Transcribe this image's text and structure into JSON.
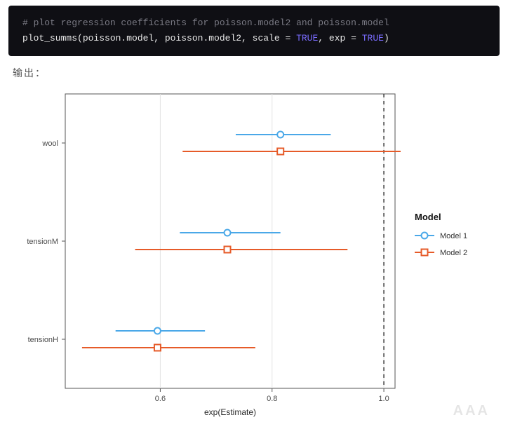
{
  "code": {
    "comment": "# plot regression coefficients for poisson.model2 and poisson.model",
    "fn": "plot_summs",
    "args_plain1": "(poisson.model, poisson.model2, scale = ",
    "bool1": "TRUE",
    "args_plain2": ", exp = ",
    "bool2": "TRUE",
    "args_plain3": ")"
  },
  "output_label": "输出：",
  "watermark": "AAA",
  "legend": {
    "title": "Model",
    "items": [
      {
        "label": "Model 1",
        "color": "#4aa8e8",
        "shape": "circle"
      },
      {
        "label": "Model 2",
        "color": "#e65b29",
        "shape": "square"
      }
    ]
  },
  "chart_data": {
    "type": "scatter",
    "title": "",
    "xlabel": "exp(Estimate)",
    "ylabel": "",
    "xlim": [
      0.43,
      1.02
    ],
    "x_ticks": [
      0.6,
      0.8,
      1.0
    ],
    "y_categories": [
      "wool",
      "tensionM",
      "tensionH"
    ],
    "reference_line": 1.0,
    "series": [
      {
        "name": "Model 1",
        "color": "#4aa8e8",
        "shape": "circle",
        "points": [
          {
            "y": "wool",
            "x": 0.815,
            "low": 0.735,
            "high": 0.905
          },
          {
            "y": "tensionM",
            "x": 0.72,
            "low": 0.635,
            "high": 0.815
          },
          {
            "y": "tensionH",
            "x": 0.595,
            "low": 0.52,
            "high": 0.68
          }
        ]
      },
      {
        "name": "Model 2",
        "color": "#e65b29",
        "shape": "square",
        "points": [
          {
            "y": "wool",
            "x": 0.815,
            "low": 0.64,
            "high": 1.03
          },
          {
            "y": "tensionM",
            "x": 0.72,
            "low": 0.555,
            "high": 0.935
          },
          {
            "y": "tensionH",
            "x": 0.595,
            "low": 0.46,
            "high": 0.77
          }
        ]
      }
    ]
  }
}
